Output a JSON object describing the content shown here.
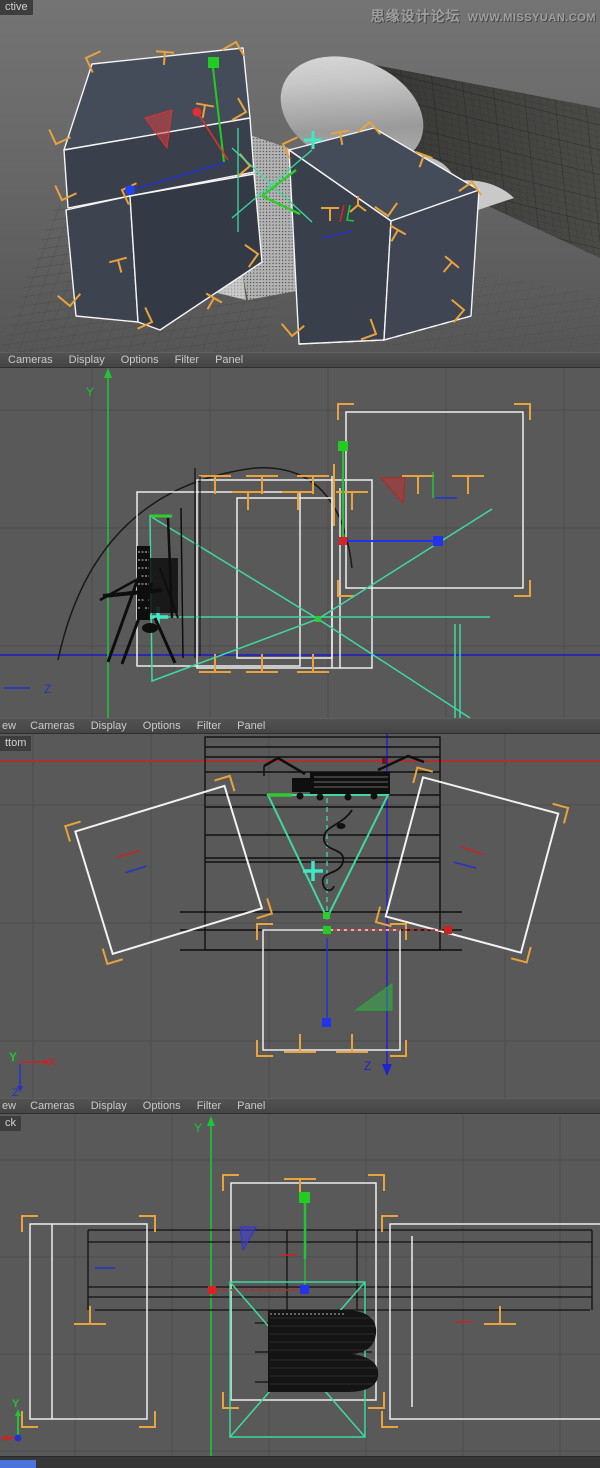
{
  "watermark": {
    "site_cn": "思缘设计论坛",
    "site_url": "WWW.MISSYUAN.COM"
  },
  "menu": {
    "prefix_partial": "ew",
    "items": [
      "Cameras",
      "Display",
      "Options",
      "Filter",
      "Panel"
    ]
  },
  "viewport_labels": {
    "perspective_partial": "ctive",
    "bottom_partial": "ttom",
    "back_partial": "ck"
  },
  "axes": {
    "x": "X",
    "y": "Y",
    "z": "Z"
  },
  "right_icons": [
    "pan-move-icon",
    "zoom-icon",
    "rotate-icon"
  ],
  "colors": {
    "viewport_bg": "#585858",
    "grid_line": "#4d4d4d",
    "menu_bg": "#4a4a4a",
    "menu_text": "#c9c9c9",
    "wireframe_white": "#f2f2f2",
    "bracket_orange": "#e9a33c",
    "axis_green": "#21c437",
    "axis_red": "#cc2222",
    "axis_blue": "#2233cc",
    "camera_teal": "#3fd9a0",
    "cross_teal": "#3fe8c4",
    "box_fill": "#3f4652",
    "paper_gray": "#c4c4c4",
    "selection_blue": "#4a74dc",
    "label_text": "#d2d2d2",
    "watermark_text": "#9f9f9f"
  }
}
